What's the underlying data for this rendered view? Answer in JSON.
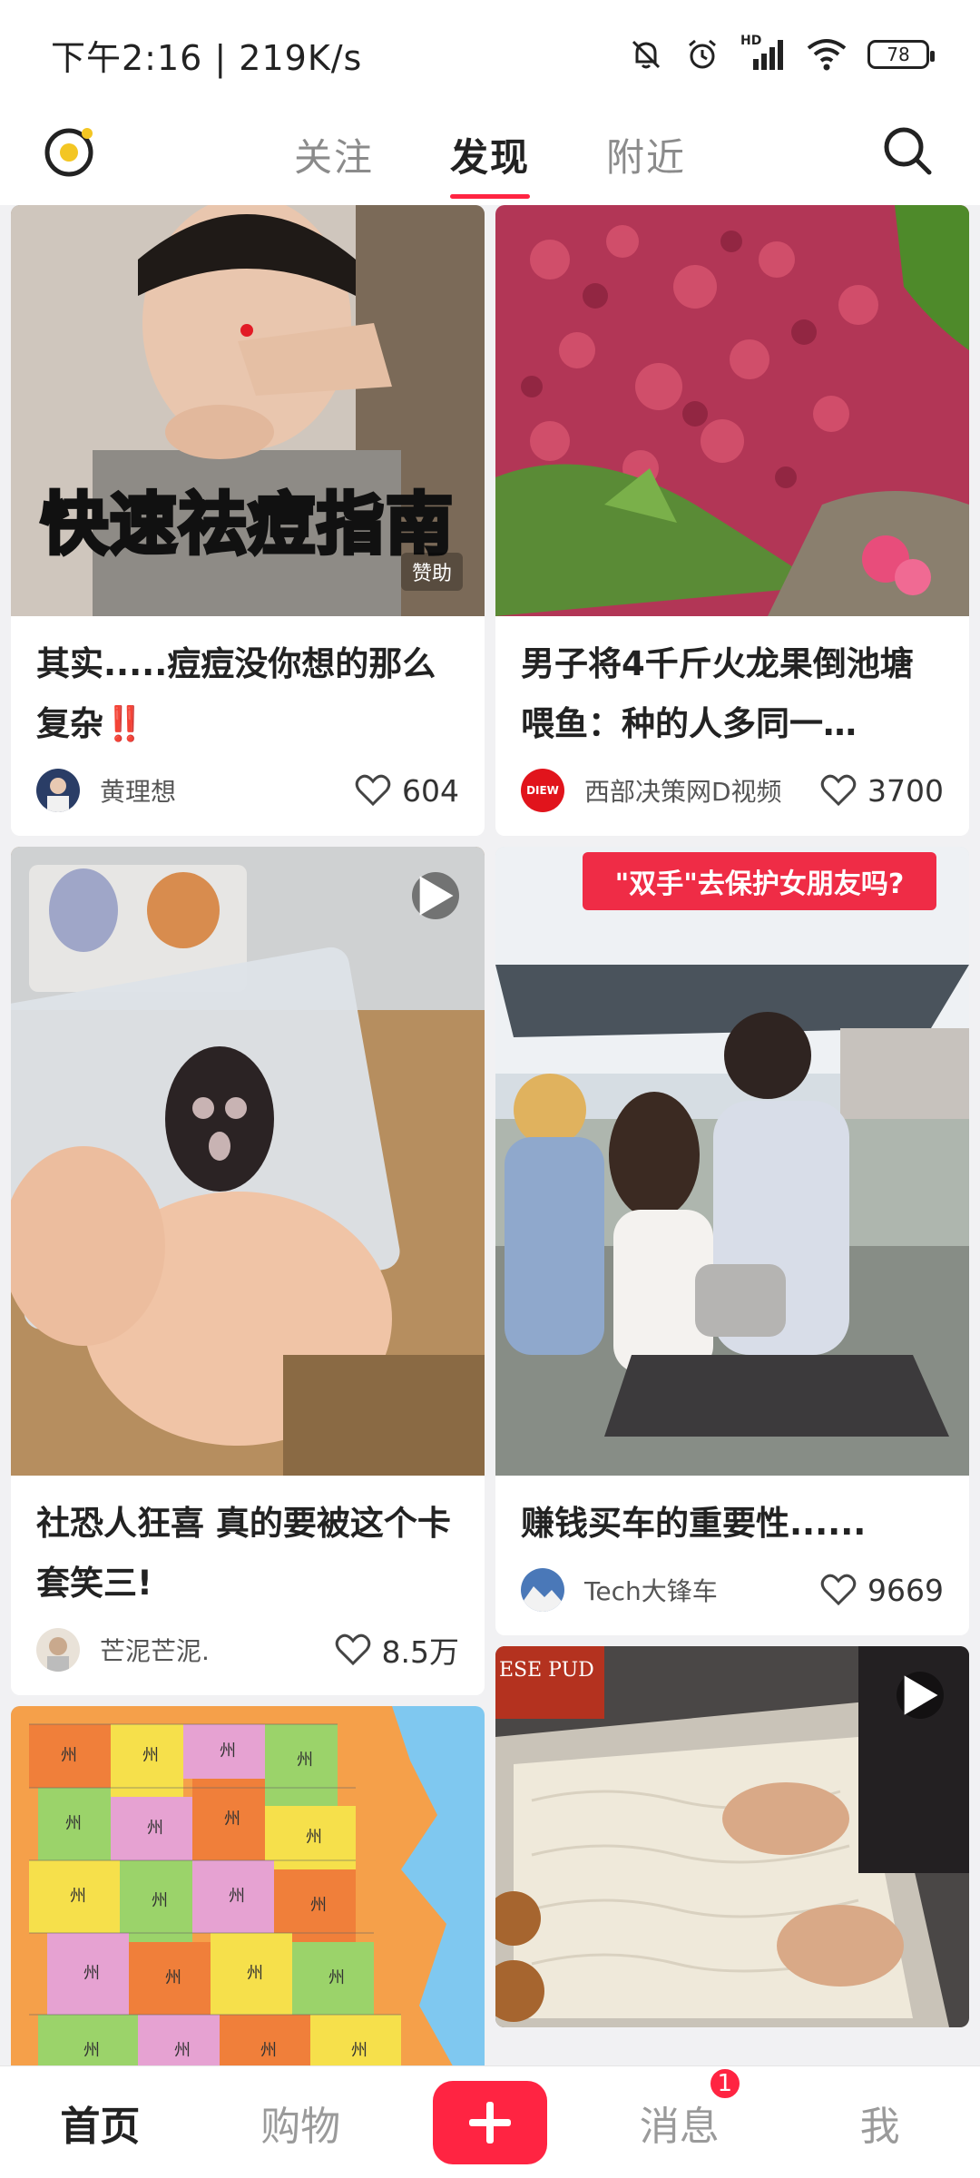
{
  "status_bar": {
    "time_speed": "下午2:16 | 219K/s",
    "network_label": "HD",
    "battery_level": "78"
  },
  "top_nav": {
    "tabs": [
      {
        "label": "关注",
        "active": false
      },
      {
        "label": "发现",
        "active": true
      },
      {
        "label": "附近",
        "active": false
      }
    ],
    "logo_icon": "app-logo-icon",
    "search_icon": "search-icon"
  },
  "feed": {
    "left_column": [
      {
        "cover_caption": "快速祛痘指南",
        "cover_tag": "赞助",
        "title": "其实.....痘痘没你想的那么复杂‼️",
        "author": "黄理想",
        "likes": "604",
        "cover_kind": "photo-portrait"
      },
      {
        "title": "社恐人狂喜 真的要被这个卡套笑三!",
        "author": "芒泥芒泥.",
        "likes": "8.5万",
        "cover_kind": "video",
        "play_icon": "play-icon"
      },
      {
        "title": "",
        "cover_kind": "map",
        "map_labels": [
          "州",
          "州",
          "州",
          "州",
          "州",
          "州",
          "州",
          "州"
        ]
      }
    ],
    "right_column": [
      {
        "title": "男子将4千斤火龙果倒池塘喂鱼：种的人多同一…",
        "author": "西部决策网D视频",
        "author_logo_text": "DIEW",
        "likes": "3700",
        "cover_kind": "photo-flowers"
      },
      {
        "cover_banner": "\"双手\"去保护女朋友吗?",
        "title": "赚钱买车的重要性......",
        "author": "Tech大锋车",
        "likes": "9669",
        "cover_kind": "photo-scooter"
      },
      {
        "title": "",
        "cover_kind": "video",
        "cover_sign": "ESE PUD",
        "play_icon": "play-icon"
      }
    ]
  },
  "bottom_nav": {
    "items": [
      {
        "label": "首页",
        "active": true
      },
      {
        "label": "购物",
        "active": false
      },
      {
        "label": "消息",
        "active": false,
        "badge": "1"
      },
      {
        "label": "我",
        "active": false
      }
    ],
    "post_icon": "plus-icon"
  },
  "colors": {
    "accent": "#ff2442",
    "background": "#f1f1f3"
  }
}
